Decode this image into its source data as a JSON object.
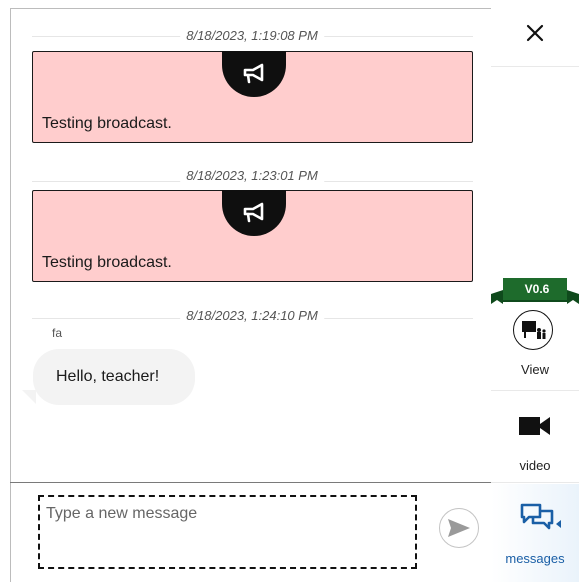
{
  "messages": [
    {
      "type": "broadcast",
      "timestamp": "8/18/2023, 1:19:08 PM",
      "text": "Testing broadcast.",
      "icon": "megaphone-icon"
    },
    {
      "type": "broadcast",
      "timestamp": "8/18/2023, 1:23:01 PM",
      "text": "Testing broadcast.",
      "icon": "megaphone-icon"
    },
    {
      "type": "chat",
      "timestamp": "8/18/2023, 1:24:10 PM",
      "sender": "fa",
      "text": "Hello, teacher!"
    }
  ],
  "composer": {
    "placeholder": "Type a new message",
    "value": "",
    "send_icon": "send-icon"
  },
  "sidebar": {
    "close_icon": "close-icon",
    "version": "V0.6",
    "items": [
      {
        "label": "View",
        "icon": "classroom-view-icon",
        "active": false
      },
      {
        "label": "video",
        "icon": "video-camera-icon",
        "active": false
      },
      {
        "label": "messages",
        "icon": "chat-bubbles-icon",
        "active": true
      }
    ]
  },
  "colors": {
    "broadcast_bg": "#ffcdcd",
    "ribbon_green": "#1e6b2c",
    "active_blue": "#1a5fa6",
    "chat_bubble": "#f3f3f3"
  }
}
